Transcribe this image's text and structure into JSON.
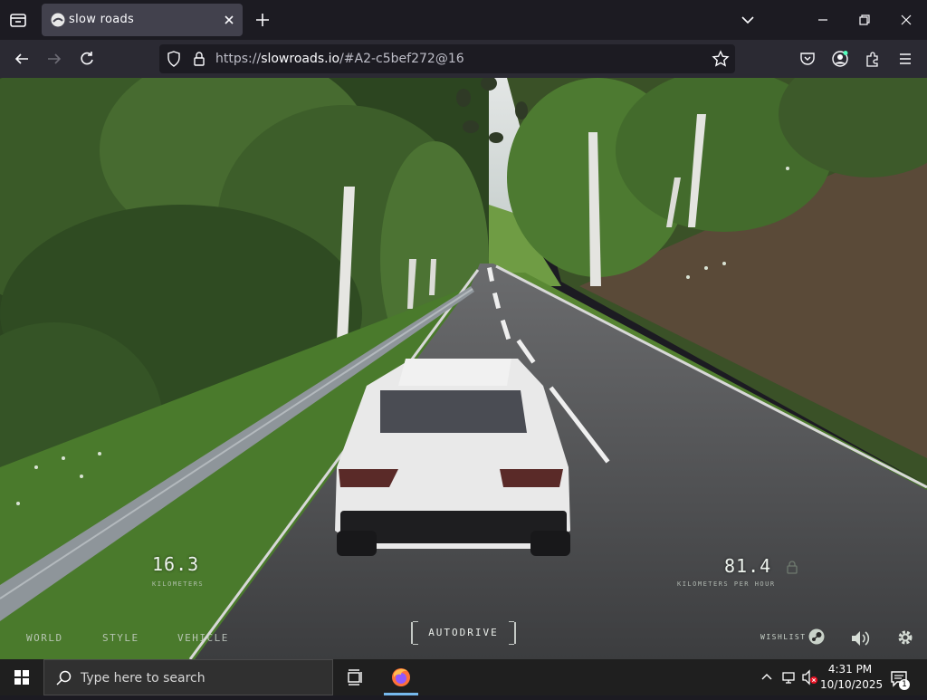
{
  "browser": {
    "tab_title": "slow roads",
    "url_scheme": "https://",
    "url_host": "slowroads.io",
    "url_rest": "/#A2-c5bef272@16"
  },
  "game": {
    "distance_value": "16.3",
    "distance_unit": "KILOMETERS",
    "speed_value": "81.4",
    "speed_unit": "KILOMETERS PER HOUR",
    "menu": [
      "WORLD",
      "STYLE",
      "VEHICLE"
    ],
    "autodrive_label": "AUTODRIVE",
    "wishlist_label": "WISHLIST"
  },
  "taskbar": {
    "search_placeholder": "Type here to search",
    "time": "4:31 PM",
    "date": "10/10/2025",
    "notification_count": "1"
  },
  "colors": {
    "browser_bg": "#1c1b22",
    "navbar_bg": "#2b2a33",
    "tab_active": "#42414d",
    "road": "#4a4a4c",
    "foliage": "#3b5a2c",
    "car": "#e9e9e9",
    "taskbar_bg": "#1f1f1f"
  }
}
